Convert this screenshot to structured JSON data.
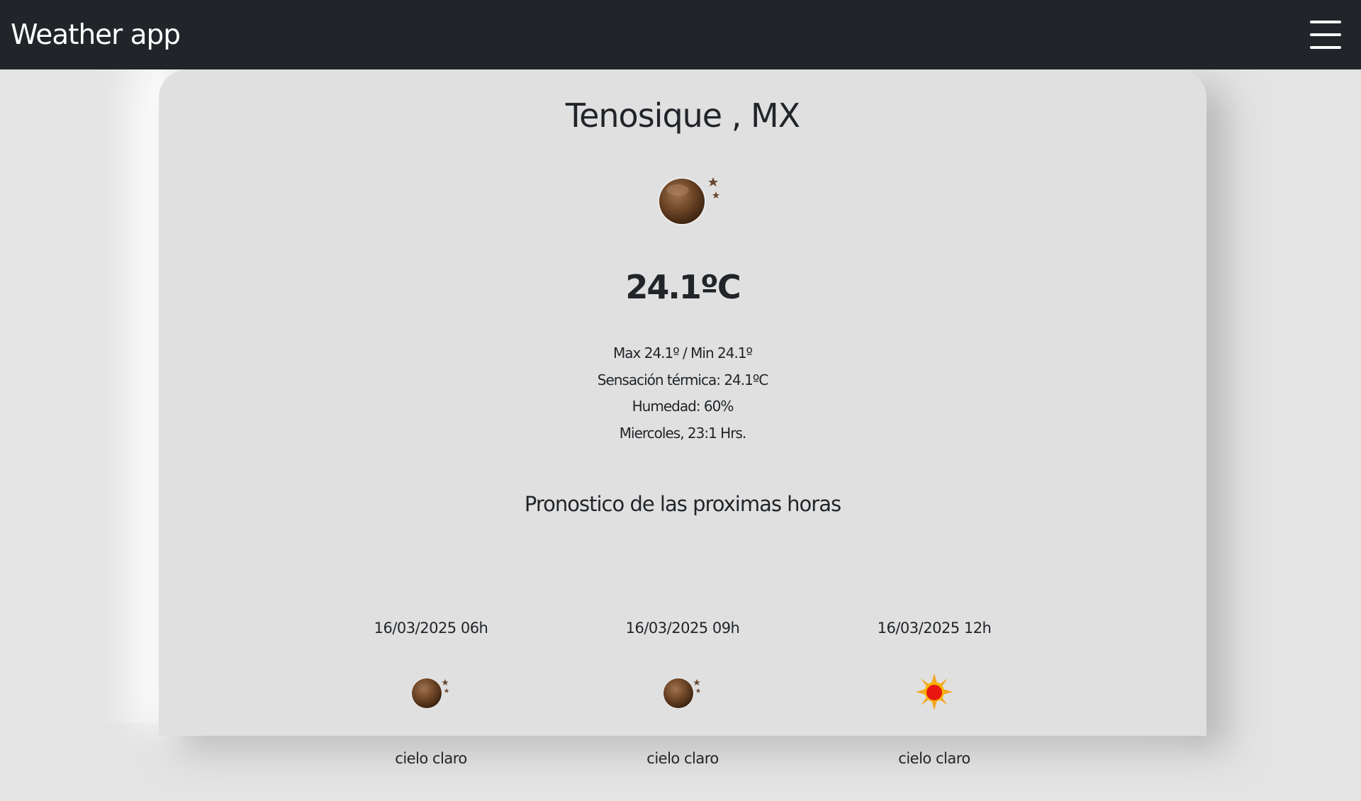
{
  "navbar": {
    "brand": "Weather app",
    "menu_icon": "hamburger-menu-icon"
  },
  "current": {
    "city": "Tenosique , MX",
    "icon": "clear-night-moon-icon",
    "temperature": "24.1ºC",
    "max_min": "Max 24.1º / Min 24.1º",
    "feels_like": "Sensación térmica: 24.1ºC",
    "humidity": "Humedad: 60%",
    "datetime": "Miercoles, 23:1 Hrs."
  },
  "forecast": {
    "title": "Pronostico de las proximas horas",
    "items": [
      {
        "date": "16/03/2025 06h",
        "icon": "clear-night-moon-icon",
        "description": "cielo claro"
      },
      {
        "date": "16/03/2025 09h",
        "icon": "clear-night-moon-icon",
        "description": "cielo claro"
      },
      {
        "date": "16/03/2025 12h",
        "icon": "sun-icon",
        "description": "cielo claro"
      }
    ]
  },
  "colors": {
    "navbar_bg": "#212529",
    "page_bg": "#e4e4e4",
    "card_bg": "#e0e0e0",
    "text": "#212529"
  }
}
